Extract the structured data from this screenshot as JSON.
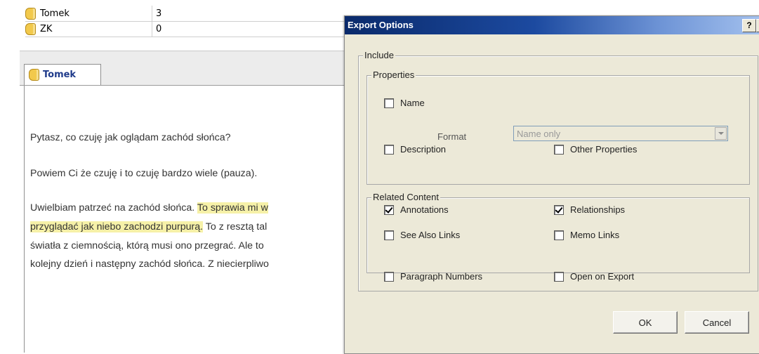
{
  "list": {
    "rows": [
      {
        "name": "Tomek",
        "count": "3"
      },
      {
        "name": "ZK",
        "count": "0"
      }
    ]
  },
  "tab": {
    "label": "Tomek"
  },
  "document": {
    "p1": "Pytasz, co czuję jak oglądam zachód słońca?",
    "p2": "Powiem Ci że czuję i to czuję bardzo wiele (pauza).",
    "p3_line1_plain": "Uwielbiam patrzeć na zachód słońca. ",
    "p3_line1_hl": "To sprawia mi w",
    "p3_line2_hl": "przyglądać  jak niebo zachodzi purpurą.",
    "p3_line2_plain": " To z resztą tal",
    "p3_line3": "światła z ciemnością, którą musi ono przegrać.  Ale to",
    "p3_line4": "kolejny dzień i następny zachód słońca. Z niecierpliwo"
  },
  "dialog": {
    "title": "Export Options",
    "help_label": "?",
    "include_label": "Include",
    "properties_label": "Properties",
    "name_label": "Name",
    "format_label": "Format",
    "format_value": "Name only",
    "description_label": "Description",
    "other_properties_label": "Other Properties",
    "related_label": "Related Content",
    "annotations_label": "Annotations",
    "relationships_label": "Relationships",
    "see_also_label": "See Also Links",
    "memo_links_label": "Memo Links",
    "paragraph_numbers_label": "Paragraph Numbers",
    "open_on_export_label": "Open on Export",
    "ok_label": "OK",
    "cancel_label": "Cancel",
    "checked": {
      "name": false,
      "description": false,
      "other_properties": false,
      "annotations": true,
      "relationships": true,
      "see_also": false,
      "memo_links": false,
      "paragraph_numbers": false,
      "open_on_export": false
    }
  }
}
